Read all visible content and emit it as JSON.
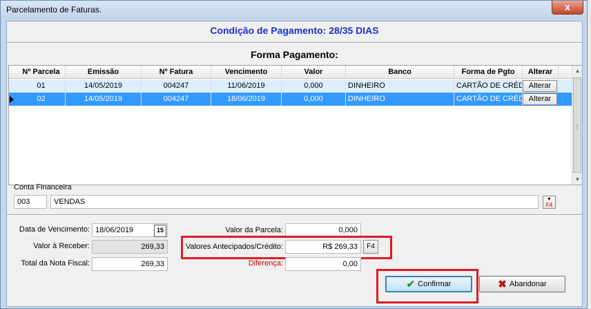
{
  "window": {
    "title": "Parcelamento de Faturas.",
    "close_label": "x"
  },
  "header": {
    "condition": "Condição de Pagamento: 28/35 DIAS",
    "section_title": "Forma Pagamento:"
  },
  "grid": {
    "columns": [
      "Nº Parcela",
      "Emissão",
      "Nº Fatura",
      "Vencimento",
      "Valor",
      "Banco",
      "Forma de Pgto",
      "Alterar"
    ],
    "rows": [
      {
        "parcela": "01",
        "emissao": "14/05/2019",
        "fatura": "004247",
        "vencimento": "11/06/2019",
        "valor": "0,000",
        "banco": "DINHEIRO",
        "forma": "CARTÃO DE CRÉDITO",
        "alterar": "Alterar"
      },
      {
        "parcela": "02",
        "emissao": "14/05/2019",
        "fatura": "004247",
        "vencimento": "18/06/2019",
        "valor": "0,000",
        "banco": "DINHEIRO",
        "forma": "CARTÃO DE CRÉDITO",
        "alterar": "Alterar"
      }
    ],
    "selected_row": 1
  },
  "conta": {
    "label": "Conta Financeira",
    "code": "003",
    "name": "VENDAS",
    "lookup_label": "F4"
  },
  "fields": {
    "vencimento_label": "Data de Vencimento:",
    "vencimento_value": "18/06/2019",
    "calendar_label": "15",
    "receber_label": "Valor à Receber:",
    "receber_value": "269,33",
    "total_label": "Total da Nota Fiscal:",
    "total_value": "269,33",
    "parcela_label": "Valor da Parcela:",
    "parcela_value": "0,000",
    "antecipados_label": "Valores Antecipados/Crédito:",
    "antecipados_value": "R$ 269,33",
    "antecipados_f4": "F4",
    "diferenca_label": "Diferença:",
    "diferenca_value": "0,00"
  },
  "buttons": {
    "confirmar": "Confirmar",
    "abandonar": "Abandonar"
  },
  "colors": {
    "accent_blue": "#1b2fcc",
    "selection": "#3399ff",
    "highlight_red": "#e01b24"
  }
}
